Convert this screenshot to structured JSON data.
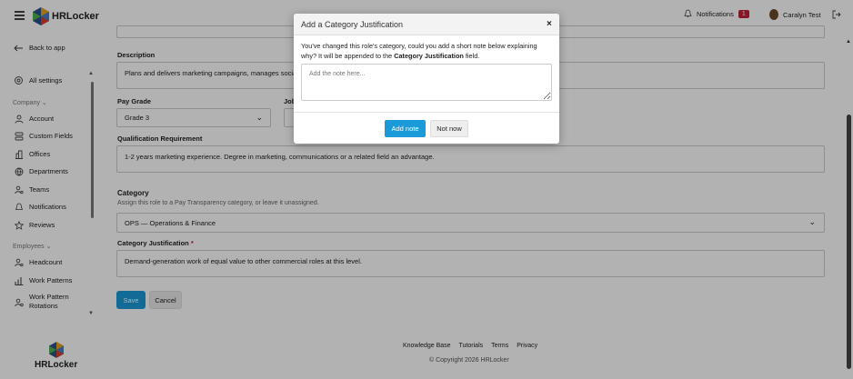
{
  "header": {
    "brand": "HRLocker",
    "notifications_label": "Notifications",
    "notifications_count": "1",
    "user_name": "Caralyn Test"
  },
  "sidebar": {
    "back_label": "Back to app",
    "all_settings": "All settings",
    "company_section": "Company",
    "company_items": [
      "Account",
      "Custom Fields",
      "Offices",
      "Departments",
      "Teams",
      "Notifications",
      "Reviews"
    ],
    "employees_section": "Employees",
    "employee_items": [
      "Headcount",
      "Work Patterns",
      "Work Pattern Rotations"
    ]
  },
  "form": {
    "description_label": "Description",
    "description_value": "Plans and delivers marketing campaigns, manages social",
    "pay_grade_label": "Pay Grade",
    "pay_grade_value": "Grade 3",
    "job_label_partial": "Job",
    "qualification_label": "Qualification Requirement",
    "qualification_value": "1-2 years marketing experience. Degree in marketing, communications or a related field an advantage.",
    "category_label": "Category",
    "category_hint": "Assign this role to a Pay Transparency category, or leave it unassigned.",
    "category_value": "OPS — Operations & Finance",
    "justification_label": "Category Justification",
    "justification_required": "*",
    "justification_value": "Demand-generation work of equal value to other commercial roles at this level.",
    "save_label": "Save",
    "cancel_label": "Cancel"
  },
  "footer": {
    "brand": "HRLocker",
    "links": [
      "Knowledge Base",
      "Tutorials",
      "Terms",
      "Privacy"
    ],
    "copyright": "© Copyright 2026 HRLocker"
  },
  "modal": {
    "title": "Add a Category Justification",
    "close_symbol": "×",
    "text_before": "You've changed this role's category, could you add a short note below explaining why? It will be appended to the ",
    "text_bold": "Category Justification",
    "text_after": " field.",
    "placeholder": "Add the note here...",
    "add_label": "Add note",
    "notnow_label": "Not now"
  },
  "colors": {
    "accent": "#1a9ad8",
    "badge": "#c0203a"
  }
}
